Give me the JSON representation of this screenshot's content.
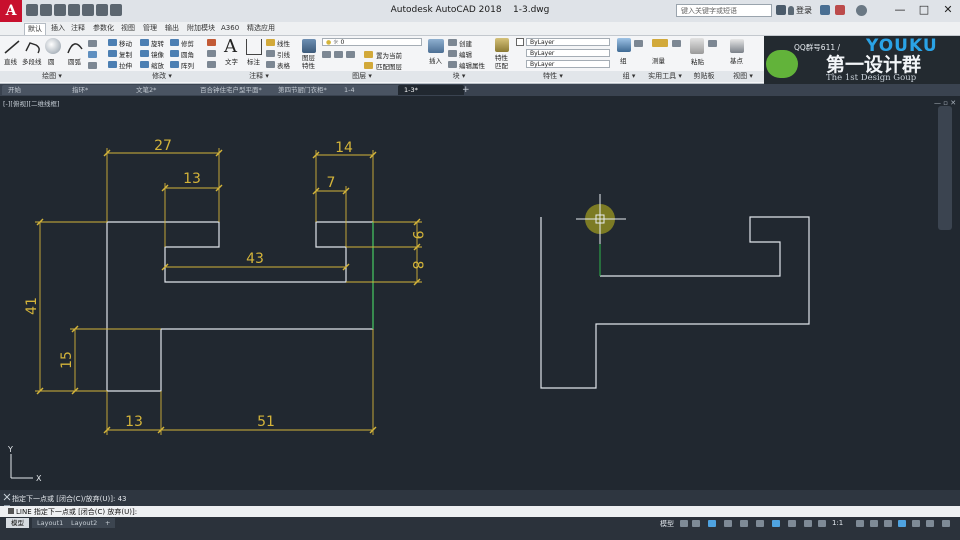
{
  "app": {
    "logo_letter": "A",
    "title": "Autodesk AutoCAD 2018",
    "filename": "1-3.dwg",
    "search_placeholder": "键入关键字或短语",
    "login": "登录",
    "window_buttons": [
      "—",
      "□",
      "✕"
    ]
  },
  "ribbon_tabs": [
    "默认",
    "插入",
    "注释",
    "参数化",
    "视图",
    "管理",
    "输出",
    "附加模块",
    "A360",
    "精选应用"
  ],
  "ribbon": {
    "draw": {
      "buttons": [
        "直线",
        "多段线",
        "圆",
        "圆弧"
      ],
      "footer": "绘图 ▾"
    },
    "modify": {
      "items": [
        "移动",
        "旋转",
        "修剪",
        "复制",
        "镜像",
        "圆角",
        "拉伸",
        "缩放",
        "阵列"
      ],
      "footer": "修改 ▾"
    },
    "annotation": {
      "buttons": [
        "文字",
        "标注"
      ],
      "items": [
        "线性",
        "引线",
        "表格"
      ],
      "footer": "注释 ▾"
    },
    "layers": {
      "big": "图层\n特性",
      "layer_value": "0",
      "items": [
        "置为当前",
        "匹配图层"
      ],
      "footer": "图层 ▾"
    },
    "block": {
      "big": "插入",
      "items": [
        "创建",
        "编辑",
        "编辑属性"
      ],
      "footer": "块 ▾"
    },
    "properties": {
      "big": "特性\n匹配",
      "combos": [
        "ByLayer",
        "ByLayer",
        "ByLayer"
      ],
      "footer": "特性 ▾"
    },
    "groups": {
      "big": "组",
      "footer": "组 ▾"
    },
    "utilities": {
      "big": "测量",
      "footer": "实用工具 ▾"
    },
    "clipboard": {
      "big": "粘贴",
      "footer": "剪贴板"
    },
    "view": {
      "big": "基点",
      "footer": "视图 ▾"
    }
  },
  "brand": {
    "qq_text": "QQ群号611 /",
    "youku": "YOUKU",
    "name_cn": "第一设计群",
    "name_en": "The 1st Design Goup"
  },
  "file_tabs": [
    "开始",
    "指环*",
    "文笔2*",
    "百合钟住宅户型平面*",
    "第四节厨门衣柜*",
    "1-4",
    "1-3*"
  ],
  "active_file_tab": "1-3*",
  "view_label": "[-][俯视][二维线框]",
  "drawing": {
    "dimensions": [
      "27",
      "14",
      "13",
      "7",
      "43",
      "9",
      "8",
      "41",
      "15",
      "13",
      "51"
    ],
    "ucs_y": "Y",
    "ucs_x": "X"
  },
  "command": {
    "history": "指定下一点或 [闭合(C)/放弃(U)]: 43",
    "current": "LINE 指定下一点或 [闭合(C) 放弃(U)]:"
  },
  "layout_tabs": [
    "模型",
    "Layout1",
    "Layout2",
    "+"
  ],
  "status": {
    "model_label": "模型",
    "scale": "1:1"
  },
  "colors": {
    "canvas": "#212830",
    "geometry": "#dfe4ea",
    "dimension": "#d4b43a",
    "accent_red": "#c8102e"
  }
}
